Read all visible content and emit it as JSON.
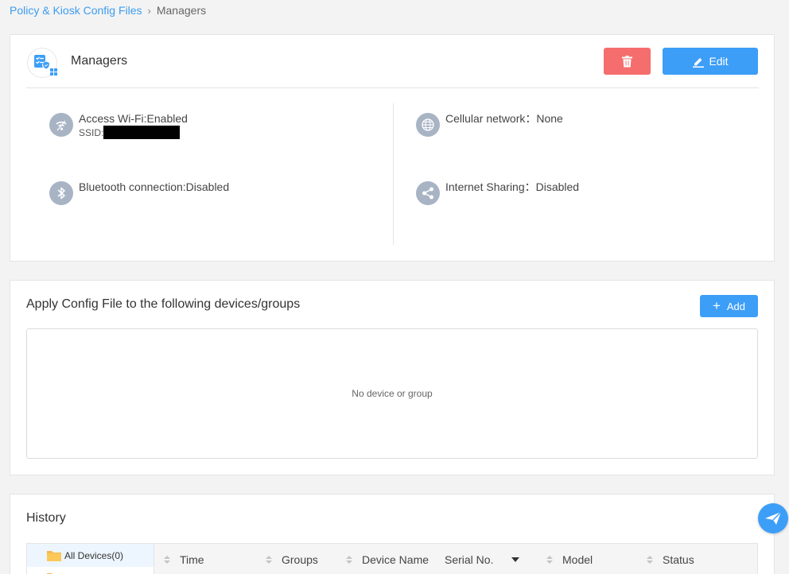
{
  "breadcrumb": {
    "parent": "Policy & Kiosk Config Files",
    "current": "Managers"
  },
  "profile": {
    "name": "Managers",
    "edit_label": "Edit",
    "settings": {
      "wifi": {
        "label": "Access Wi-Fi:Enabled",
        "ssid_label": "SSID:"
      },
      "cellular": {
        "label": "Cellular network：None"
      },
      "bluetooth": {
        "label": "Bluetooth connection:Disabled"
      },
      "sharing": {
        "label": "Internet Sharing：Disabled"
      }
    }
  },
  "apply": {
    "title": "Apply Config File to the following devices/groups",
    "add_label": "Add",
    "empty_text": "No device or group"
  },
  "history": {
    "title": "History",
    "tree": [
      {
        "label": "All Devices(0)"
      }
    ],
    "columns": [
      "Time",
      "Groups",
      "Device Name",
      "Serial No.",
      "Model",
      "Status"
    ]
  },
  "colors": {
    "accent": "#3d9ef7",
    "danger": "#f56d6d",
    "icon_gray": "#a8b4c4"
  },
  "icons": [
    "profile-logo-icon",
    "trash-icon",
    "edit-pencil-icon",
    "wifi-icon",
    "globe-icon",
    "bluetooth-icon",
    "share-icon",
    "plus-icon",
    "folder-icon",
    "sort-icon",
    "send-icon"
  ]
}
